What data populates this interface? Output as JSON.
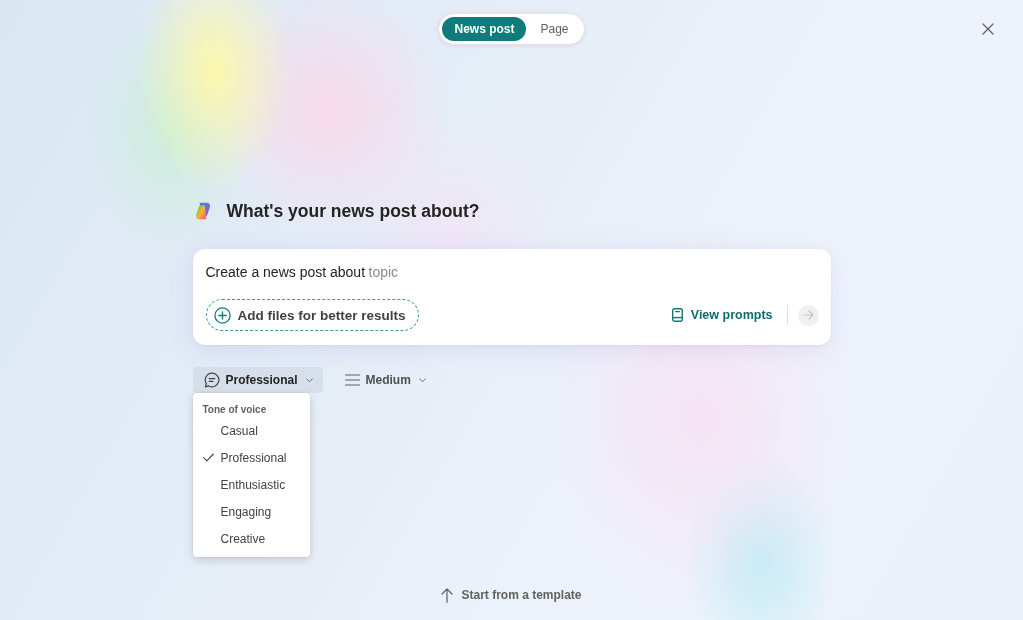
{
  "mode_toggle": [
    {
      "label": "News post",
      "selected": true
    },
    {
      "label": "Page",
      "selected": false
    }
  ],
  "heading": "What's your news post about?",
  "prompt": {
    "value": "Create a news post about",
    "placeholder": "topic",
    "attach_button": "Add files for better results",
    "prompts_button": "View prompts",
    "send_disabled": true
  },
  "options": [
    {
      "label": "Professional",
      "kind": "tone",
      "expanded": true
    },
    {
      "label": "Medium",
      "kind": "length",
      "expanded": false
    }
  ],
  "tone_menu": {
    "header": "Tone of voice",
    "items": [
      {
        "label": "Casual",
        "checked": false
      },
      {
        "label": "Professional",
        "checked": true
      },
      {
        "label": "Enthusiastic",
        "checked": false
      },
      {
        "label": "Engaging",
        "checked": false
      },
      {
        "label": "Creative",
        "checked": false
      }
    ]
  },
  "template_link": "Start from a template"
}
